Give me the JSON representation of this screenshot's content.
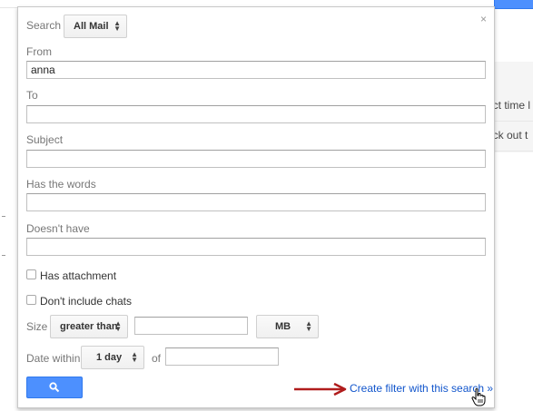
{
  "background": {
    "row1_text": "ect time l",
    "row2_text": "eck out t"
  },
  "panel": {
    "close_symbol": "×",
    "search_label": "Search",
    "search_scope": "All Mail",
    "from_label": "From",
    "from_value": "anna",
    "to_label": "To",
    "to_value": "",
    "subject_label": "Subject",
    "subject_value": "",
    "has_words_label": "Has the words",
    "has_words_value": "",
    "doesnt_have_label": "Doesn't have",
    "doesnt_have_value": "",
    "has_attachment_label": "Has attachment",
    "dont_include_chats_label": "Don't include chats",
    "size_label": "Size",
    "size_operator": "greater than",
    "size_value": "",
    "size_unit": "MB",
    "date_within_label": "Date within",
    "date_within_value": "1 day",
    "of_label": "of",
    "of_value": "",
    "create_filter_link": "Create filter with this search »"
  },
  "colors": {
    "accent": "#4d90fe",
    "link": "#1155cc",
    "annotation_arrow": "#b01c1c"
  },
  "icons": {
    "search_button_icon": "magnifier-icon",
    "pointer": "hand-cursor-icon",
    "annotation": "red-arrow-icon"
  }
}
